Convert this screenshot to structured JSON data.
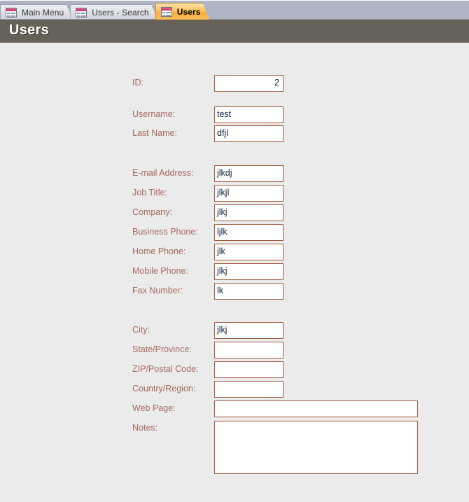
{
  "window": {
    "tabs": [
      {
        "label": "Main Menu",
        "icon": "form-table-icon",
        "active": false
      },
      {
        "label": "Users - Search",
        "icon": "form-table-icon",
        "active": false
      },
      {
        "label": "Users",
        "icon": "form-table-icon",
        "active": true
      }
    ]
  },
  "form": {
    "title": "Users",
    "header_color": "#666259",
    "label_color": "#a36a5e",
    "field_border_color": "#a05c3f",
    "background_color": "#ebebeb",
    "fields": [
      {
        "name": "id",
        "label": "ID:",
        "value": "2",
        "align": "right"
      },
      {
        "name": "username",
        "label": "Username:",
        "value": "test",
        "align": "left"
      },
      {
        "name": "last-name",
        "label": "Last Name:",
        "value": "dfjl",
        "align": "left"
      },
      {
        "name": "email-address",
        "label": "E-mail Address:",
        "value": "jlkdj",
        "align": "left"
      },
      {
        "name": "job-title",
        "label": "Job Title:",
        "value": "jlkjl",
        "align": "left"
      },
      {
        "name": "company",
        "label": "Company:",
        "value": "jlkj",
        "align": "left"
      },
      {
        "name": "business-phone",
        "label": "Business Phone:",
        "value": "ljlk",
        "align": "left"
      },
      {
        "name": "home-phone",
        "label": "Home Phone:",
        "value": "jlk",
        "align": "left"
      },
      {
        "name": "mobile-phone",
        "label": "Mobile Phone:",
        "value": "jlkj",
        "align": "left"
      },
      {
        "name": "fax-number",
        "label": "Fax Number:",
        "value": "lk",
        "align": "left"
      },
      {
        "name": "city",
        "label": "City:",
        "value": "jlkj",
        "align": "left"
      },
      {
        "name": "state-province",
        "label": "State/Province:",
        "value": "",
        "align": "left"
      },
      {
        "name": "zip-postal-code",
        "label": "ZIP/Postal Code:",
        "value": "",
        "align": "left"
      },
      {
        "name": "country-region",
        "label": "Country/Region:",
        "value": "",
        "align": "left"
      },
      {
        "name": "web-page",
        "label": "Web Page:",
        "value": "",
        "align": "left"
      },
      {
        "name": "notes",
        "label": "Notes:",
        "value": "",
        "align": "left"
      }
    ]
  }
}
